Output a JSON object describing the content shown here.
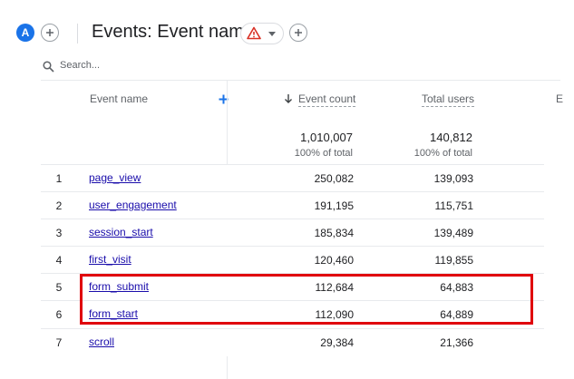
{
  "header": {
    "avatar_letter": "A",
    "title": "Events: Event name"
  },
  "search": {
    "placeholder": "Search..."
  },
  "table": {
    "columns": {
      "event_name": "Event name",
      "event_count": "Event count",
      "total_users": "Total users",
      "partial": "E"
    },
    "totals": {
      "event_count": "1,010,007",
      "event_count_pct": "100% of total",
      "total_users": "140,812",
      "total_users_pct": "100% of total"
    },
    "rows": [
      {
        "rank": "1",
        "name": "page_view",
        "event_count": "250,082",
        "total_users": "139,093"
      },
      {
        "rank": "2",
        "name": "user_engagement",
        "event_count": "191,195",
        "total_users": "115,751"
      },
      {
        "rank": "3",
        "name": "session_start",
        "event_count": "185,834",
        "total_users": "139,489"
      },
      {
        "rank": "4",
        "name": "first_visit",
        "event_count": "120,460",
        "total_users": "119,855"
      },
      {
        "rank": "5",
        "name": "form_submit",
        "event_count": "112,684",
        "total_users": "64,883"
      },
      {
        "rank": "6",
        "name": "form_start",
        "event_count": "112,090",
        "total_users": "64,889"
      },
      {
        "rank": "7",
        "name": "scroll",
        "event_count": "29,384",
        "total_users": "21,366"
      }
    ]
  },
  "colors": {
    "accent": "#1a73e8",
    "link": "#1a0dab",
    "highlight": "#e0000d",
    "warning": "#d93025"
  },
  "icons": [
    "plus-icon",
    "warning-icon",
    "chevron-down-icon",
    "search-icon",
    "arrow-down-icon"
  ]
}
